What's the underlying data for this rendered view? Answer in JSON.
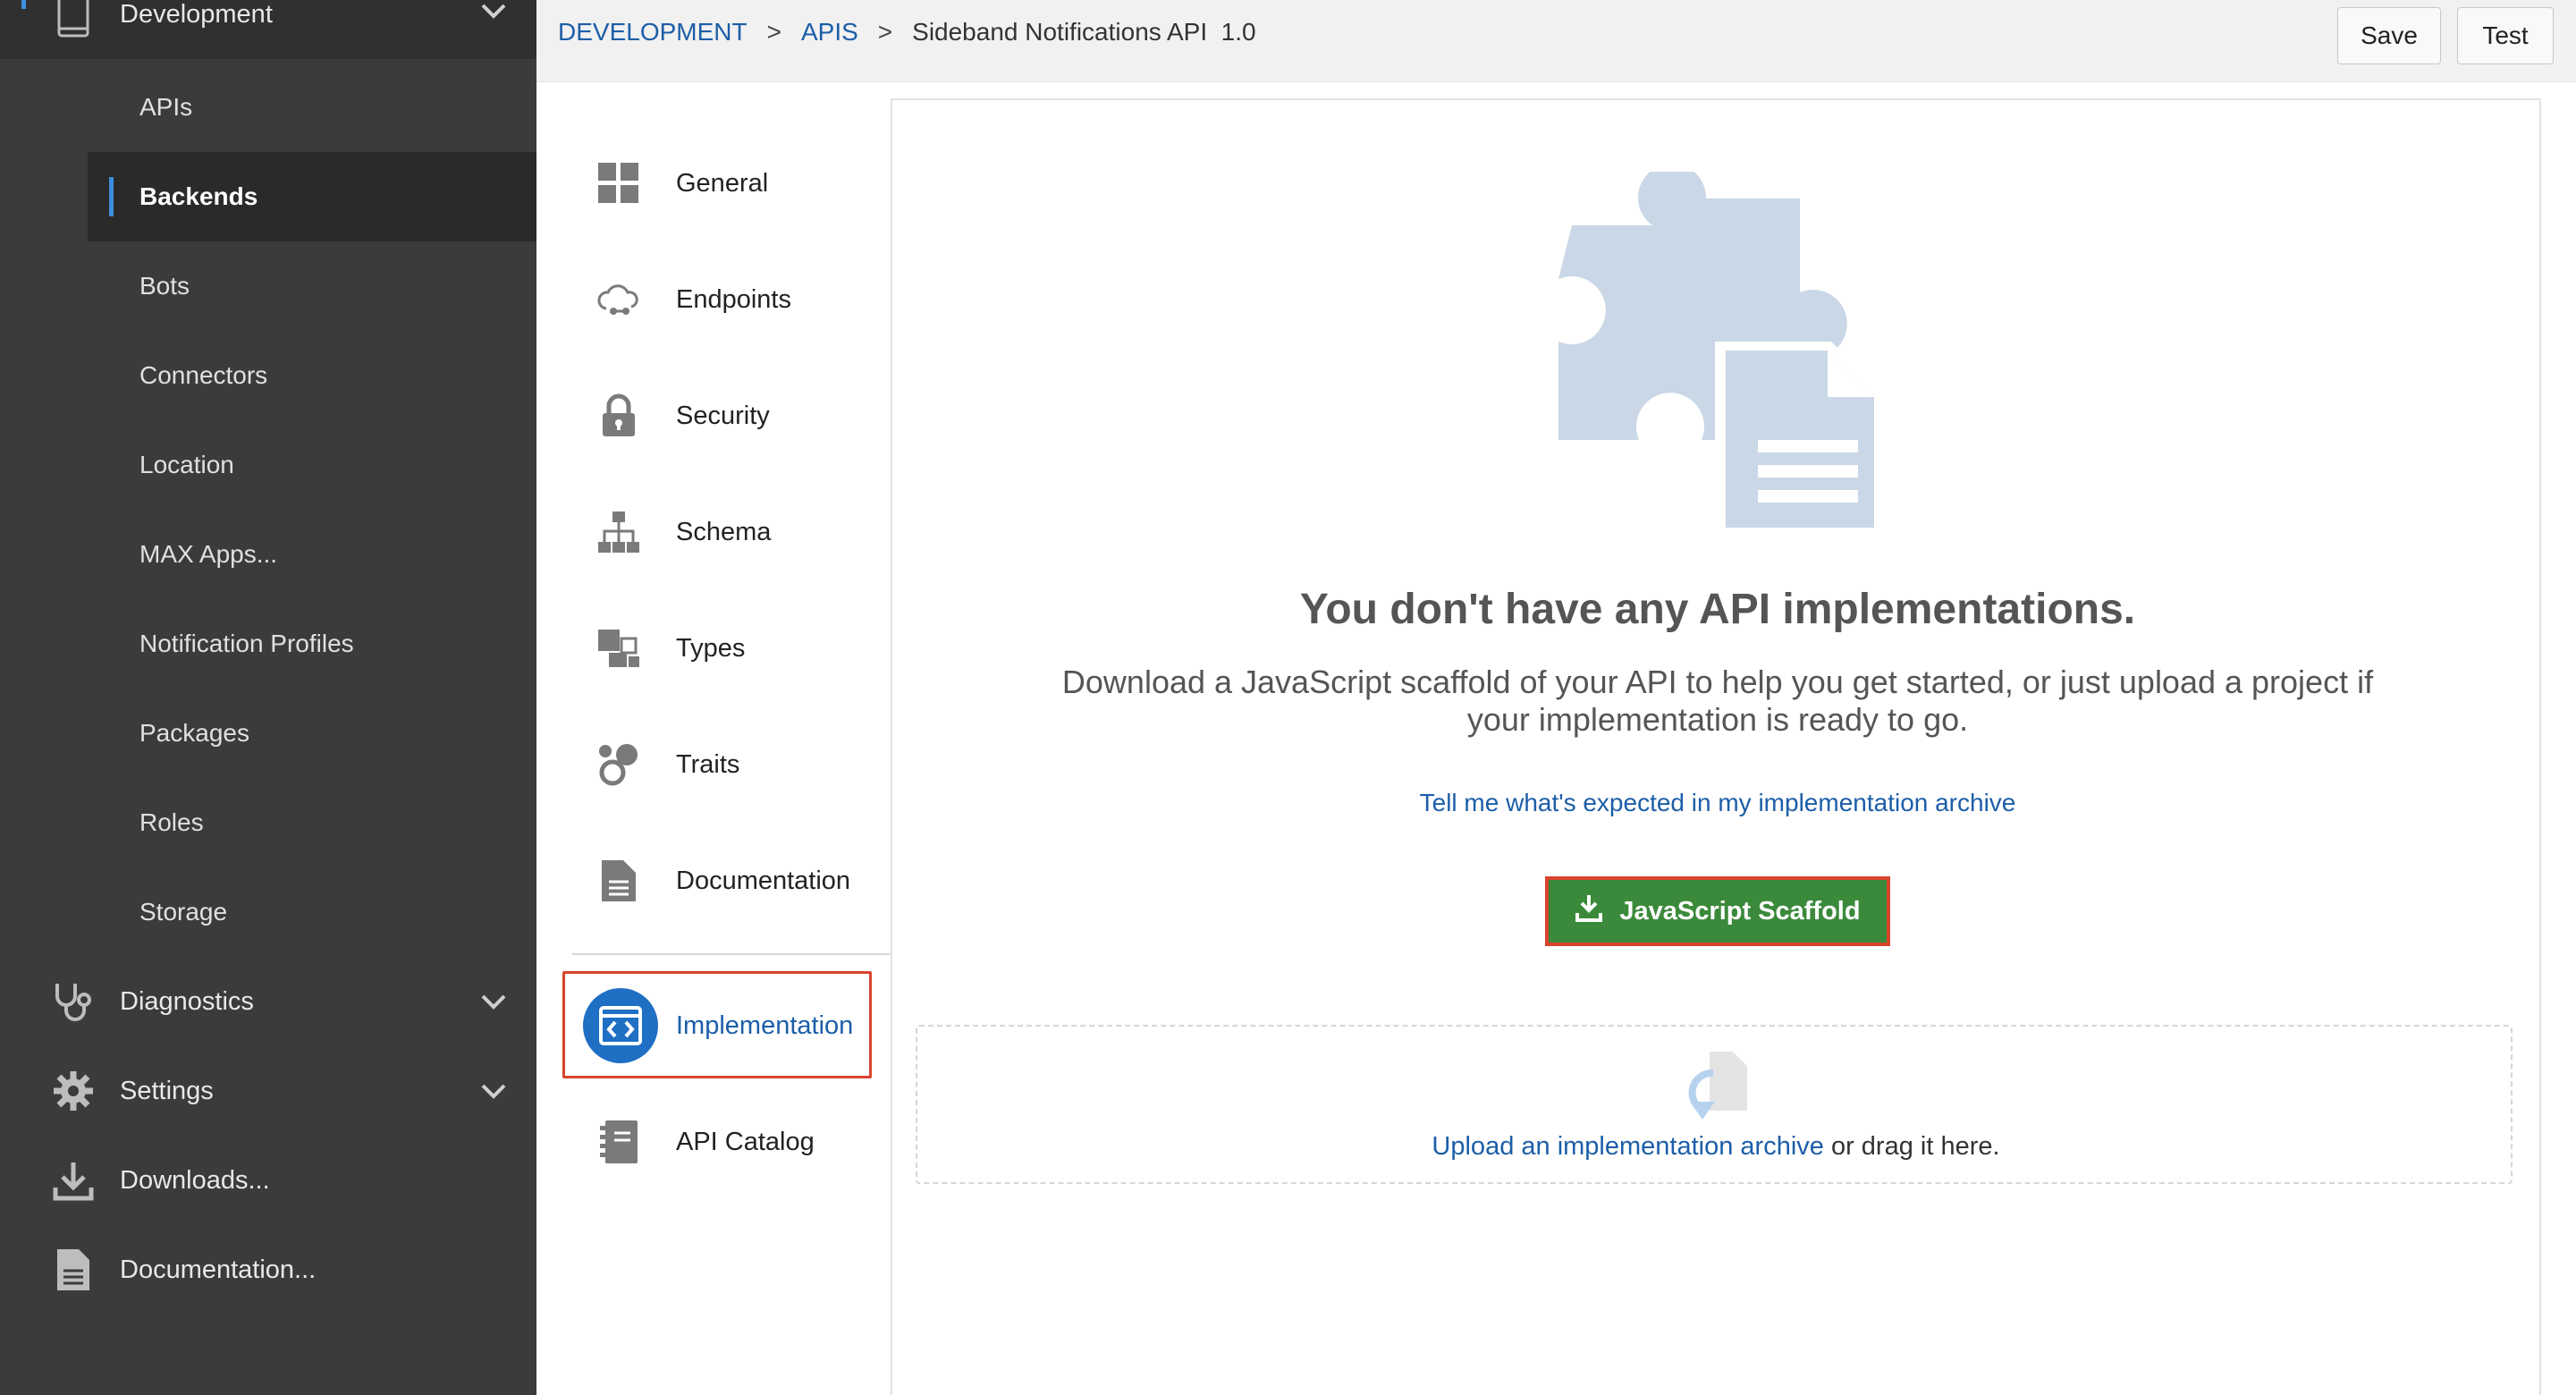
{
  "sidebar": {
    "top_section": {
      "label": "Development",
      "icon": "mobile-device-icon"
    },
    "items": [
      {
        "label": "APIs"
      },
      {
        "label": "Backends",
        "active": true
      },
      {
        "label": "Bots"
      },
      {
        "label": "Connectors"
      },
      {
        "label": "Location"
      },
      {
        "label": "MAX Apps..."
      },
      {
        "label": "Notification Profiles"
      },
      {
        "label": "Packages"
      },
      {
        "label": "Roles"
      },
      {
        "label": "Storage"
      }
    ],
    "sections": [
      {
        "label": "Diagnostics",
        "icon": "stethoscope-icon"
      },
      {
        "label": "Settings",
        "icon": "gear-icon"
      },
      {
        "label": "Downloads...",
        "icon": "download-icon"
      },
      {
        "label": "Documentation...",
        "icon": "document-icon"
      }
    ],
    "accent": "#3d8ee0"
  },
  "breadcrumb": {
    "items": [
      "DEVELOPMENT",
      "APIS"
    ],
    "separator": ">",
    "current": "Sideband Notifications API  1.0"
  },
  "toolbar": {
    "save_label": "Save",
    "test_label": "Test"
  },
  "subnav": {
    "items": [
      {
        "label": "General",
        "icon": "grid-icon"
      },
      {
        "label": "Endpoints",
        "icon": "cloud-link-icon"
      },
      {
        "label": "Security",
        "icon": "lock-icon"
      },
      {
        "label": "Schema",
        "icon": "hierarchy-icon"
      },
      {
        "label": "Types",
        "icon": "blocks-icon"
      },
      {
        "label": "Traits",
        "icon": "circles-icon"
      },
      {
        "label": "Documentation",
        "icon": "document-icon"
      }
    ],
    "active_item": {
      "label": "Implementation",
      "icon": "code-icon"
    },
    "after_item": {
      "label": "API Catalog",
      "icon": "catalog-icon"
    }
  },
  "main": {
    "illustration": "puzzle-document-icon",
    "heading": "You don't have any API implementations.",
    "description": "Download a JavaScript scaffold of your API to help you get started, or just upload a project if your implementation is ready to go.",
    "archive_help_link": "Tell me what's expected in my implementation archive",
    "scaffold_button": "JavaScript Scaffold",
    "upload_link": "Upload an implementation archive",
    "upload_suffix": " or drag it here.",
    "button_color": "#3b8a3b",
    "highlight_color": "#d9442d",
    "link_color": "#1c5ea8"
  }
}
